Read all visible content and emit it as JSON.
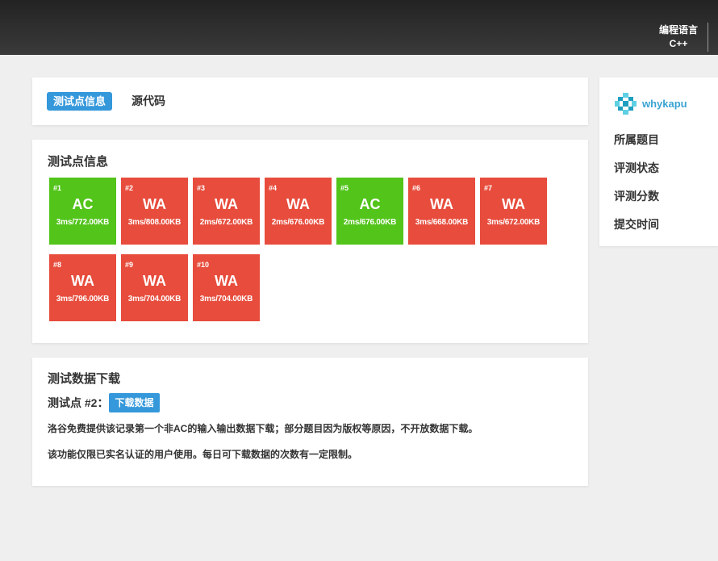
{
  "header": {
    "language_label": "编程语言",
    "language_value": "C++"
  },
  "tabs": [
    {
      "label": "测试点信息",
      "active": true
    },
    {
      "label": "源代码",
      "active": false
    }
  ],
  "testcases": {
    "title": "测试点信息",
    "cases": [
      {
        "id": "#1",
        "status": "AC",
        "detail": "3ms/772.00KB"
      },
      {
        "id": "#2",
        "status": "WA",
        "detail": "3ms/808.00KB"
      },
      {
        "id": "#3",
        "status": "WA",
        "detail": "2ms/672.00KB"
      },
      {
        "id": "#4",
        "status": "WA",
        "detail": "2ms/676.00KB"
      },
      {
        "id": "#5",
        "status": "AC",
        "detail": "2ms/676.00KB"
      },
      {
        "id": "#6",
        "status": "WA",
        "detail": "3ms/668.00KB"
      },
      {
        "id": "#7",
        "status": "WA",
        "detail": "3ms/672.00KB"
      },
      {
        "id": "#8",
        "status": "WA",
        "detail": "3ms/796.00KB"
      },
      {
        "id": "#9",
        "status": "WA",
        "detail": "3ms/704.00KB"
      },
      {
        "id": "#10",
        "status": "WA",
        "detail": "3ms/704.00KB"
      }
    ]
  },
  "download": {
    "title": "测试数据下载",
    "case_label": "测试点 #2：",
    "button_label": "下载数据",
    "note1": "洛谷免费提供该记录第一个非AC的输入输出数据下载；部分题目因为版权等原因，不开放数据下载。",
    "note2": "该功能仅限已实名认证的用户使用。每日可下载数据的次数有一定限制。"
  },
  "sidebar": {
    "user_name": "whykapu",
    "avatar_icon": "pixel-cross-avatar",
    "fields": [
      "所属题目",
      "评测状态",
      "评测分数",
      "提交时间"
    ]
  },
  "colors": {
    "page_bg": "#efefef",
    "accent": "#3498db",
    "ac": "#52c41a",
    "wa": "#e74c3c",
    "user_name": "#3aa3d2",
    "avatar_light": "#5fd0e3",
    "avatar_dark": "#1f9fc0"
  }
}
